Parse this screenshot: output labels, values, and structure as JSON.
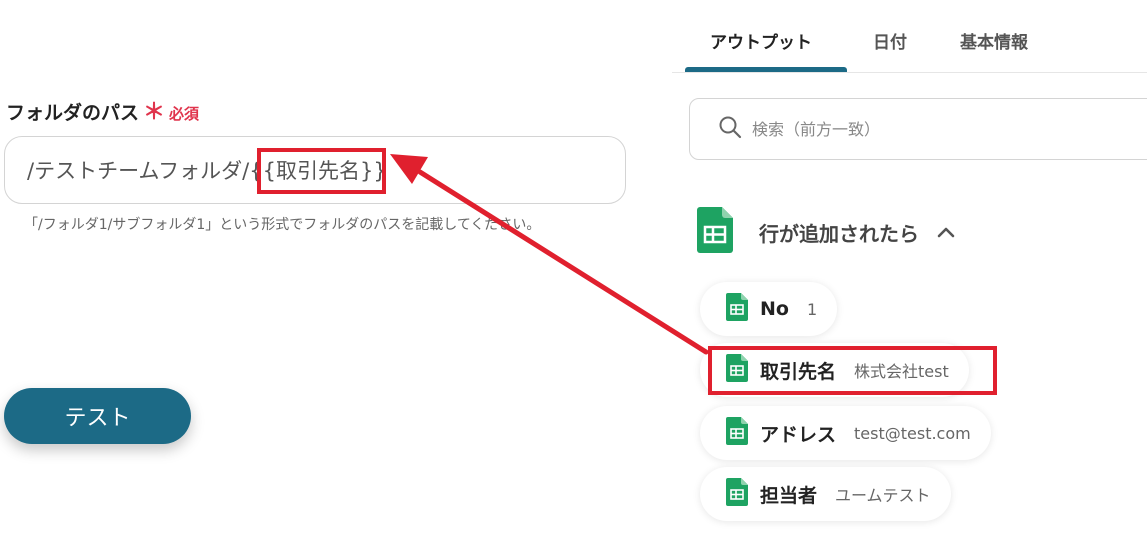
{
  "form": {
    "label": "フォルダのパス",
    "required_star": "＊",
    "required_text": "必須",
    "path_prefix": "/テストチームフォルダ/",
    "path_token": "{{取引先名}}",
    "hint": "「/フォルダ1/サブフォルダ1」という形式でフォルダのパスを記載してください。"
  },
  "test_button": "テスト",
  "tabs": [
    "アウトプット",
    "日付",
    "基本情報"
  ],
  "search": {
    "placeholder": "検索（前方一致）"
  },
  "trigger": {
    "title": "行が追加されたら"
  },
  "outputs": [
    {
      "key": "No",
      "value": "1"
    },
    {
      "key": "取引先名",
      "value": "株式会社test"
    },
    {
      "key": "アドレス",
      "value": "test@test.com"
    },
    {
      "key": "担当者",
      "value": "ユームテスト"
    }
  ],
  "colors": {
    "accent": "#1c6a86",
    "required": "#e0344c",
    "highlight": "#e0202e",
    "sheets_green": "#1ea362"
  }
}
